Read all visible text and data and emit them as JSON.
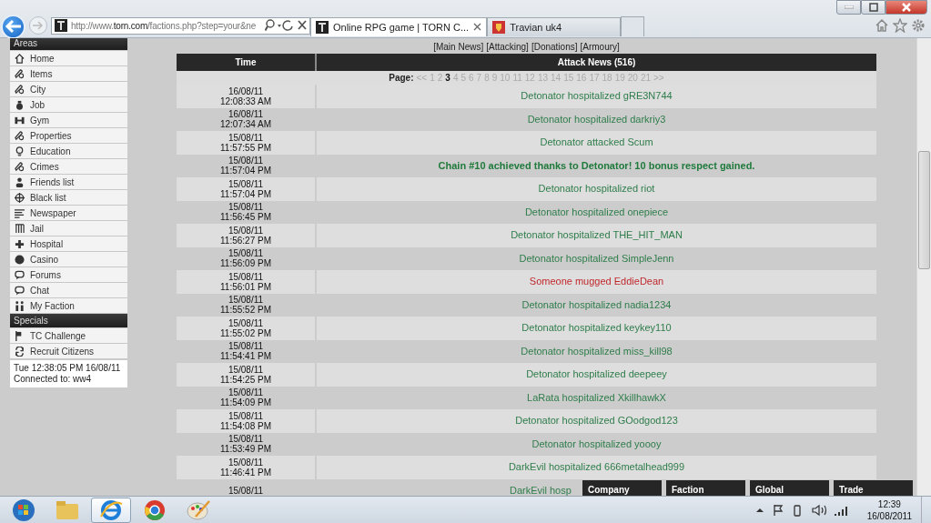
{
  "browser": {
    "address": "http://www.**torn.com**/factions.php?step=your&ne",
    "tabs": [
      {
        "title": "Online RPG game | TORN C...",
        "selected": true,
        "closable": true
      },
      {
        "title": "Travian uk4",
        "selected": false,
        "closable": false
      }
    ]
  },
  "sidebar": {
    "sections": [
      {
        "title": "Areas",
        "items": [
          "Home",
          "Items",
          "City",
          "Job",
          "Gym",
          "Properties",
          "Education",
          "Crimes",
          "Friends list",
          "Black list",
          "Newspaper",
          "Jail",
          "Hospital",
          "Casino",
          "Forums",
          "Chat",
          "My Faction"
        ]
      },
      {
        "title": "Specials",
        "items": [
          "TC Challenge",
          "Recruit Citizens"
        ]
      }
    ],
    "info": [
      "Tue 12:38:05 PM 16/08/11",
      "Connected to: ww4"
    ]
  },
  "news_links": [
    "[Main News]",
    "[Attacking]",
    "[Donations]",
    "[Armoury]"
  ],
  "table": {
    "columns": [
      "Time",
      "Attack News (516)"
    ],
    "pagination": {
      "label": "Page:",
      "prev": "<<",
      "next": ">>",
      "pages": [
        {
          "label": "1",
          "selected": false
        },
        {
          "label": "2",
          "selected": false
        },
        {
          "label": "3",
          "selected": true
        },
        {
          "label": "4",
          "selected": false
        },
        {
          "label": "5",
          "selected": false
        },
        {
          "label": "6",
          "selected": false
        },
        {
          "label": "7",
          "selected": false
        },
        {
          "label": "8",
          "selected": false
        },
        {
          "label": "9",
          "selected": false
        },
        {
          "label": "10",
          "selected": false
        },
        {
          "label": "11",
          "selected": false
        },
        {
          "label": "12",
          "selected": false
        },
        {
          "label": "13",
          "selected": false
        },
        {
          "label": "14",
          "selected": false
        },
        {
          "label": "15",
          "selected": false
        },
        {
          "label": "16",
          "selected": false
        },
        {
          "label": "17",
          "selected": false
        },
        {
          "label": "18",
          "selected": false
        },
        {
          "label": "19",
          "selected": false
        },
        {
          "label": "20",
          "selected": false
        },
        {
          "label": "21",
          "selected": false
        }
      ]
    },
    "rows": [
      {
        "date": "16/08/11",
        "time": "12:08:33 AM",
        "event": "Detonator hospitalized gRE3N744",
        "color": "#2e7d4a",
        "kind": "plain"
      },
      {
        "date": "16/08/11",
        "time": "12:07:34 AM",
        "event": "Detonator hospitalized darkriy3",
        "color": "#2e7d4a",
        "kind": "plain"
      },
      {
        "date": "15/08/11",
        "time": "11:57:55 PM",
        "event": "Detonator attacked Scum",
        "color": "#2e7d4a",
        "kind": "plain"
      },
      {
        "date": "15/08/11",
        "time": "11:57:04 PM",
        "event": "Chain #10 achieved thanks to Detonator! 10 bonus respect gained.",
        "color": "#1f7a3c",
        "kind": "chain"
      },
      {
        "date": "15/08/11",
        "time": "11:57:04 PM",
        "event": "Detonator hospitalized riot",
        "color": "#2e7d4a",
        "kind": "plain"
      },
      {
        "date": "15/08/11",
        "time": "11:56:45 PM",
        "event": "Detonator hospitalized onepiece",
        "color": "#2e7d4a",
        "kind": "plain"
      },
      {
        "date": "15/08/11",
        "time": "11:56:27 PM",
        "event": "Detonator hospitalized THE_HIT_MAN",
        "color": "#2e7d4a",
        "kind": "plain"
      },
      {
        "date": "15/08/11",
        "time": "11:56:09 PM",
        "event": "Detonator hospitalized SimpleJenn",
        "color": "#2e7d4a",
        "kind": "plain"
      },
      {
        "date": "15/08/11",
        "time": "11:56:01 PM",
        "event": "Someone mugged EddieDean",
        "color": "#c0282d",
        "kind": "plain"
      },
      {
        "date": "15/08/11",
        "time": "11:55:52 PM",
        "event": "Detonator hospitalized nadia1234",
        "color": "#2e7d4a",
        "kind": "plain"
      },
      {
        "date": "15/08/11",
        "time": "11:55:02 PM",
        "event": "Detonator hospitalized keykey110",
        "color": "#2e7d4a",
        "kind": "plain"
      },
      {
        "date": "15/08/11",
        "time": "11:54:41 PM",
        "event": "Detonator hospitalized miss_kill98",
        "color": "#2e7d4a",
        "kind": "plain"
      },
      {
        "date": "15/08/11",
        "time": "11:54:25 PM",
        "event": "Detonator hospitalized deepeey",
        "color": "#2e7d4a",
        "kind": "plain"
      },
      {
        "date": "15/08/11",
        "time": "11:54:09 PM",
        "event": "LaRata hospitalized XkillhawkX",
        "color": "#2e7d4a",
        "kind": "plain"
      },
      {
        "date": "15/08/11",
        "time": "11:54:08 PM",
        "event": "Detonator hospitalized GOodgod123",
        "color": "#2e7d4a",
        "kind": "plain"
      },
      {
        "date": "15/08/11",
        "time": "11:53:49 PM",
        "event": "Detonator hospitalized yoooy",
        "color": "#2e7d4a",
        "kind": "plain"
      },
      {
        "date": "15/08/11",
        "time": "11:46:41 PM",
        "event": "DarkEvil hospitalized 666metalhead999",
        "color": "#2e7d4a",
        "kind": "plain"
      },
      {
        "date": "15/08/11",
        "event": "DarkEvil hosp",
        "color": "#2e7d4a",
        "kind": "partial"
      }
    ]
  },
  "chat_tabs": [
    "Company",
    "Faction",
    "Global",
    "Trade"
  ],
  "taskbar": {
    "clock": "12:39",
    "date": "16/08/2011",
    "apps": [
      {
        "selected": false
      },
      {
        "selected": false
      },
      {
        "selected": true
      },
      {
        "selected": false
      },
      {
        "selected": false
      }
    ]
  }
}
